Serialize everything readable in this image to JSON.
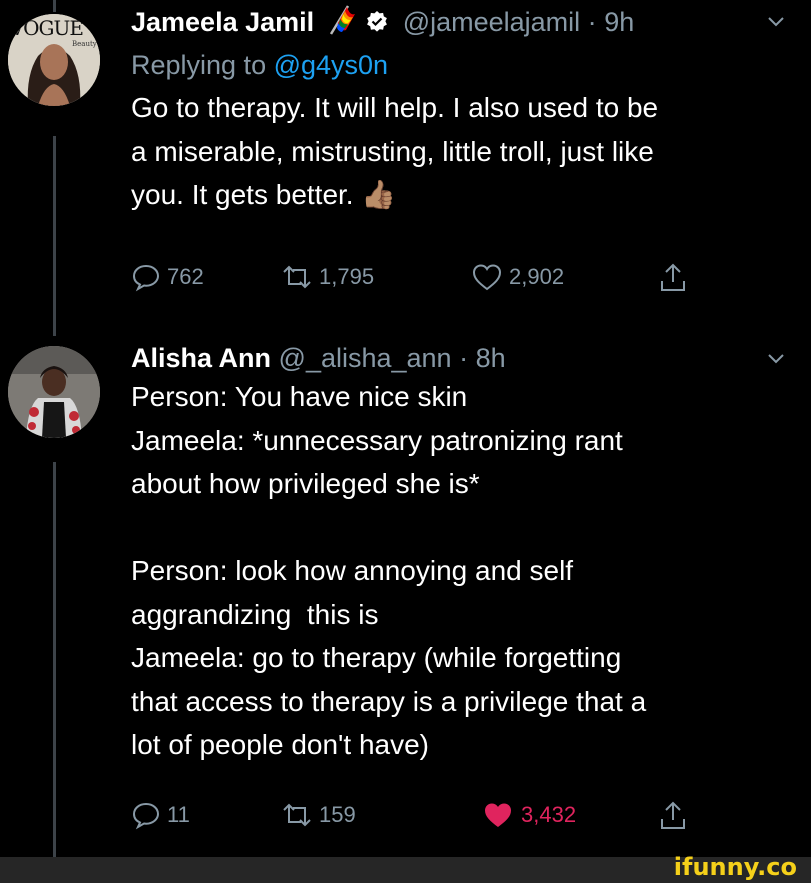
{
  "tweets": [
    {
      "name": "Jameela Jamil",
      "handle": "@jameelajamil",
      "dot": "·",
      "time": "9h",
      "replying_prefix": "Replying to ",
      "replying_mention": "@g4ys0n",
      "body": "Go to therapy. It will help. I also used to be\na miserable, mistrusting, little troll, just like\nyou. It gets better. 👍🏽",
      "replies": "762",
      "retweets": "1,795",
      "likes": "2,902",
      "avatar_text": "VOGUE",
      "avatar_subtext": "Beauty"
    },
    {
      "name": "Alisha Ann",
      "handle": "@_alisha_ann",
      "dot": "·",
      "time": "8h",
      "body": "Person: You have nice skin\nJameela: *unnecessary patronizing rant\nabout how privileged she is*\n\nPerson: look how annoying and self\naggrandizing  this is\nJameela: go to therapy (while forgetting\nthat access to therapy is a privilege that a\nlot of people don't have)",
      "replies": "11",
      "retweets": "159",
      "likes": "3,432"
    }
  ],
  "watermark": "ifunny.co",
  "icons": [
    "verified-badge-icon",
    "rainbow-flag-icon",
    "chevron-down-icon",
    "reply-icon",
    "retweet-icon",
    "like-icon",
    "share-icon"
  ],
  "colors": {
    "background": "#000000",
    "secondary_text": "#8899a6",
    "link": "#1da1f2",
    "like_active": "#e0245e",
    "watermark": "#f5d01a"
  }
}
